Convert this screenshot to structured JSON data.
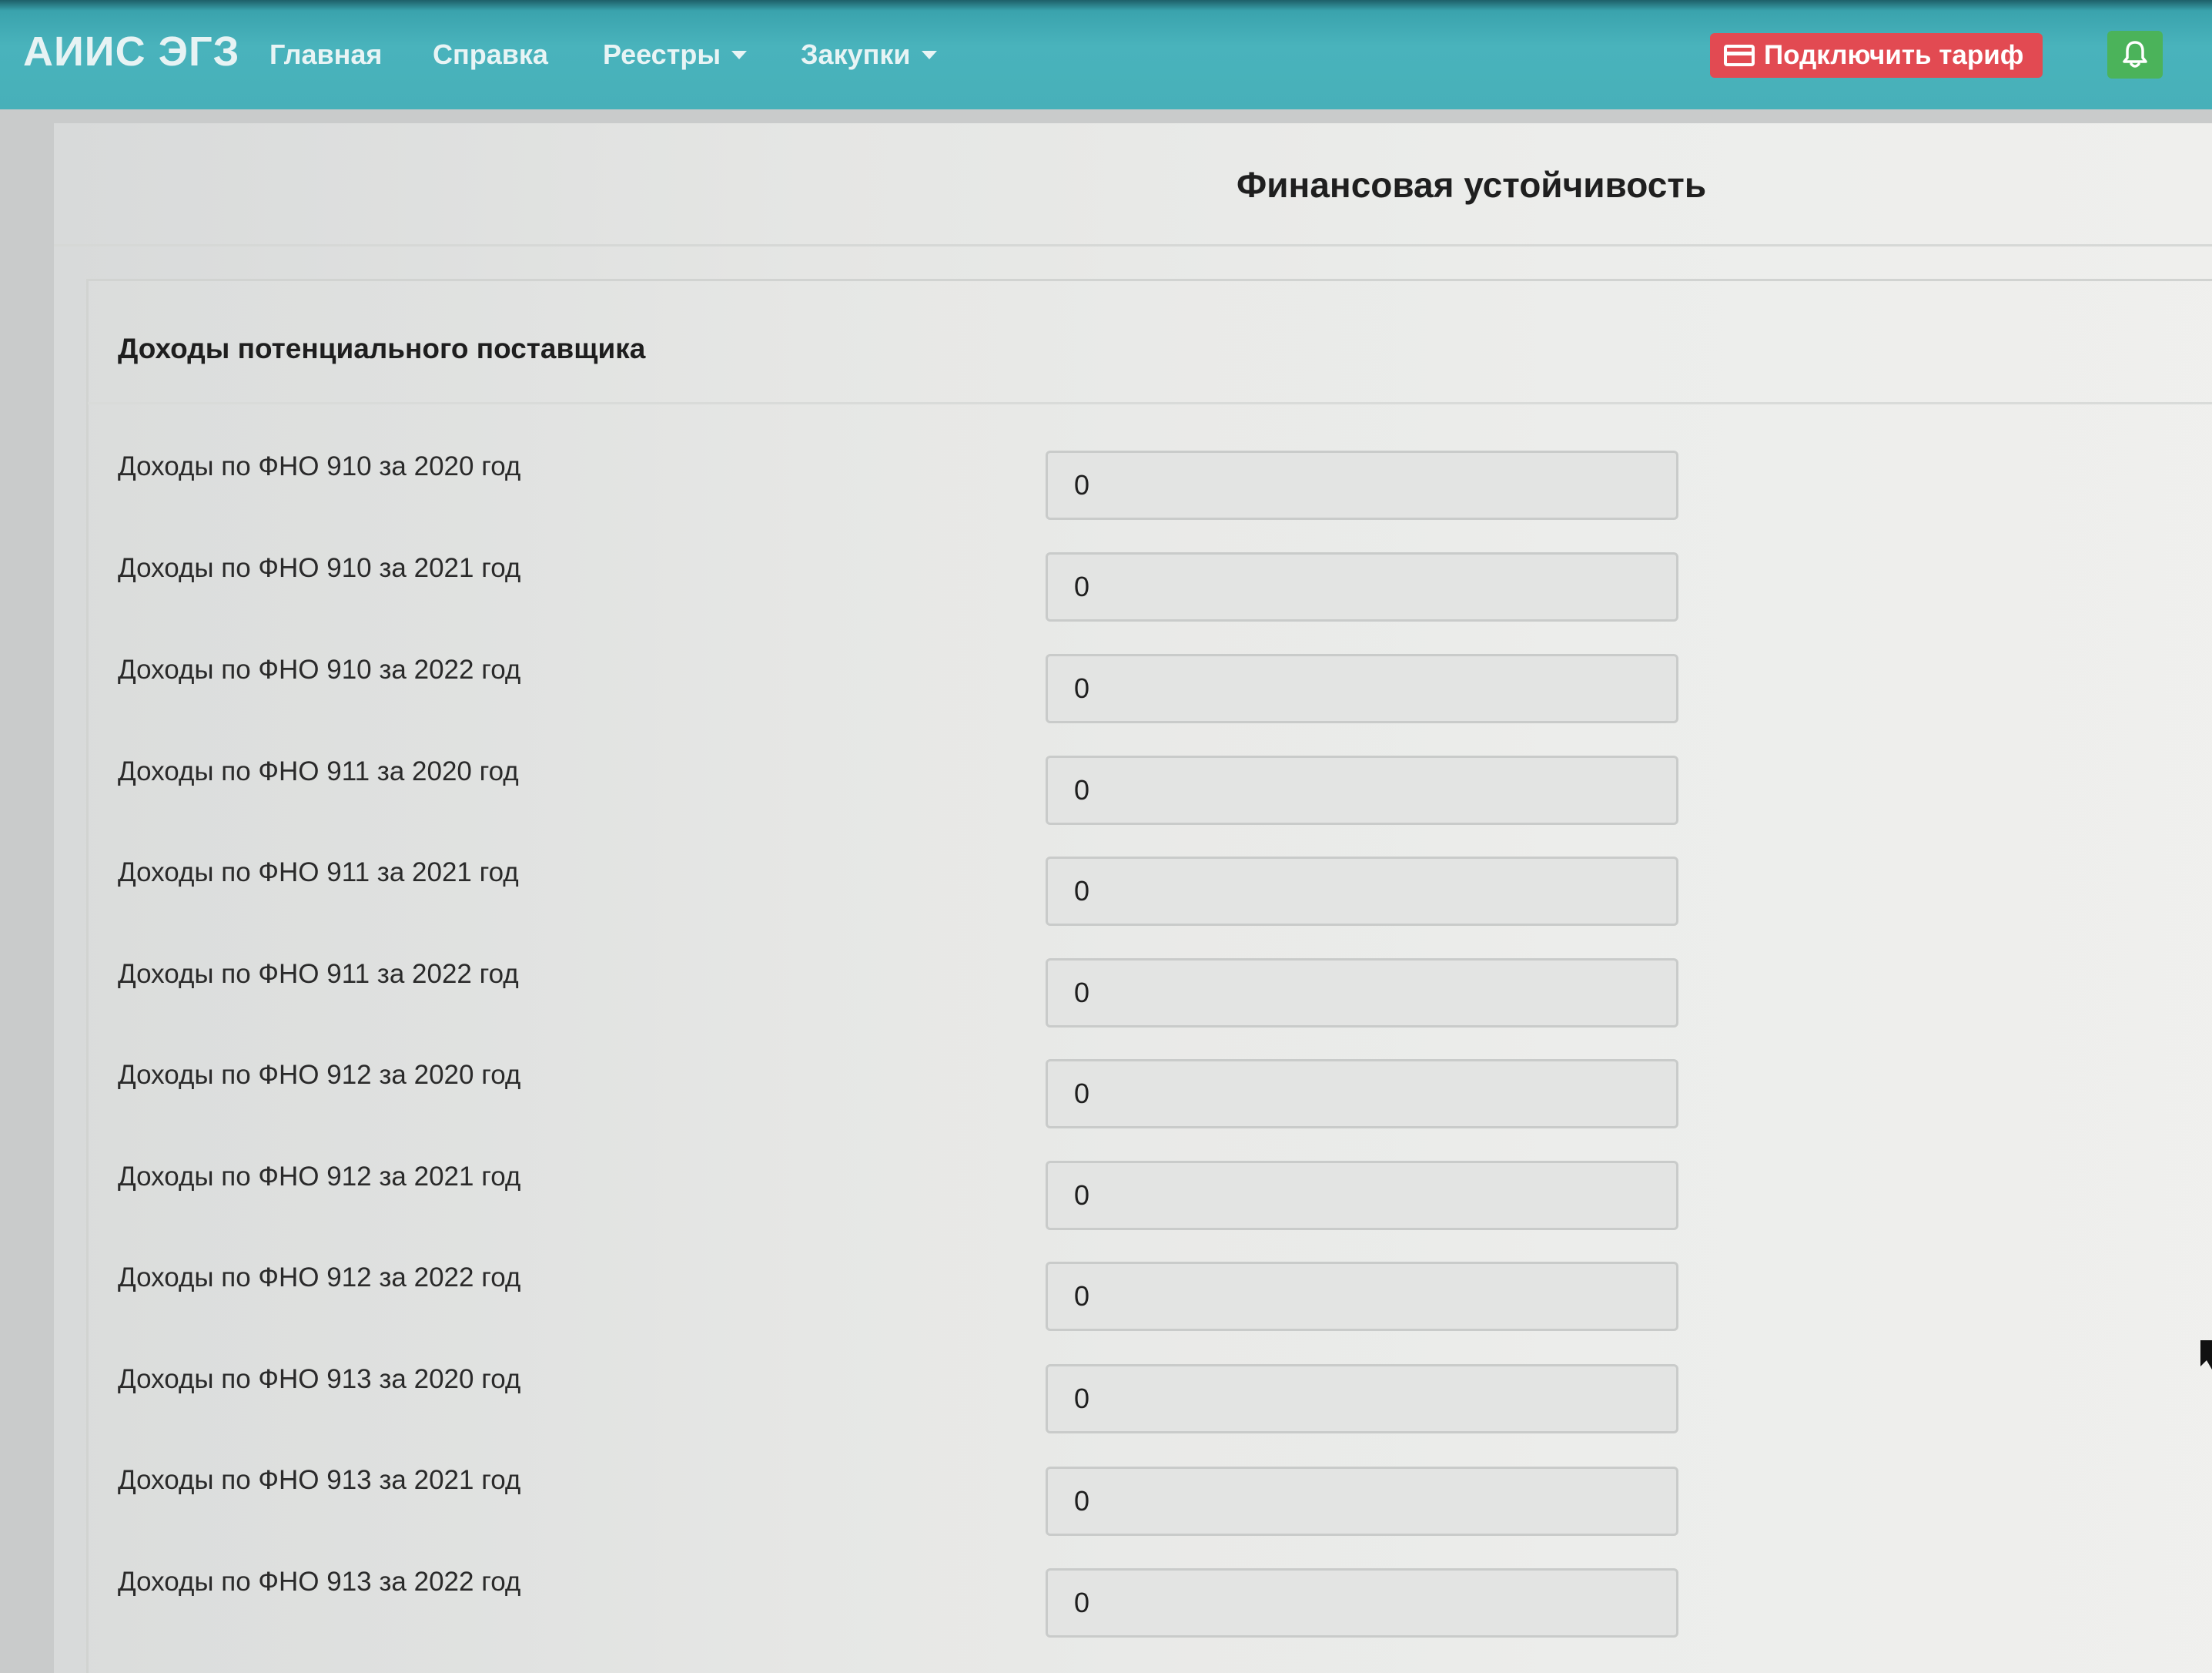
{
  "navbar": {
    "brand": "АИИС ЭГЗ",
    "links": [
      {
        "label": "Главная",
        "has_dropdown": false
      },
      {
        "label": "Справка",
        "has_dropdown": false
      },
      {
        "label": "Реестры",
        "has_dropdown": true
      },
      {
        "label": "Закупки",
        "has_dropdown": true
      }
    ],
    "tariff_button": {
      "label": "Подключить тариф",
      "icon": "credit-card-icon",
      "color": "#e24a52"
    },
    "notifications_button": {
      "icon": "bell-icon",
      "color": "#4bb35a"
    },
    "accent_color": "#47b0b9"
  },
  "page": {
    "title": "Финансовая устойчивость"
  },
  "section": {
    "title": "Доходы потенциального поставщика",
    "fields": [
      {
        "label": "Доходы по ФНО 910 за 2020 год",
        "value": "0"
      },
      {
        "label": "Доходы по ФНО 910 за 2021 год",
        "value": "0"
      },
      {
        "label": "Доходы по ФНО 910 за 2022 год",
        "value": "0"
      },
      {
        "label": "Доходы по ФНО 911 за 2020 год",
        "value": "0"
      },
      {
        "label": "Доходы по ФНО 911 за 2021 год",
        "value": "0"
      },
      {
        "label": "Доходы по ФНО 911 за 2022 год",
        "value": "0"
      },
      {
        "label": "Доходы по ФНО 912 за 2020 год",
        "value": "0"
      },
      {
        "label": "Доходы по ФНО 912 за 2021 год",
        "value": "0"
      },
      {
        "label": "Доходы по ФНО 912 за 2022 год",
        "value": "0"
      },
      {
        "label": "Доходы по ФНО 913 за 2020 год",
        "value": "0"
      },
      {
        "label": "Доходы по ФНО 913 за 2021 год",
        "value": "0"
      },
      {
        "label": "Доходы по ФНО 913 за 2022 год",
        "value": "0"
      }
    ]
  }
}
